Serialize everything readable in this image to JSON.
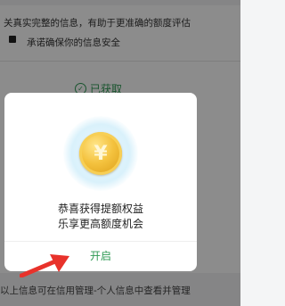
{
  "background": {
    "line1": "关真实完整的信息，有助于更准确的额度评估",
    "line2": "承诺确保你的信息安全",
    "status": "已获取",
    "footer": "以上信息可在信用管理-个人信息中查看并管理"
  },
  "dialog": {
    "message_line1": "恭喜获得提额权益",
    "message_line2": "乐享更高额度机会",
    "button_label": "开启",
    "coin_symbol": "¥"
  },
  "colors": {
    "accent_green": "#2f9a55",
    "annotation_arrow": "#e8322b",
    "coin_gold": "#f4c23e"
  },
  "icons": {
    "status": "check-circle-icon",
    "coin": "coin-icon",
    "annotation": "red-arrow-annotation"
  }
}
